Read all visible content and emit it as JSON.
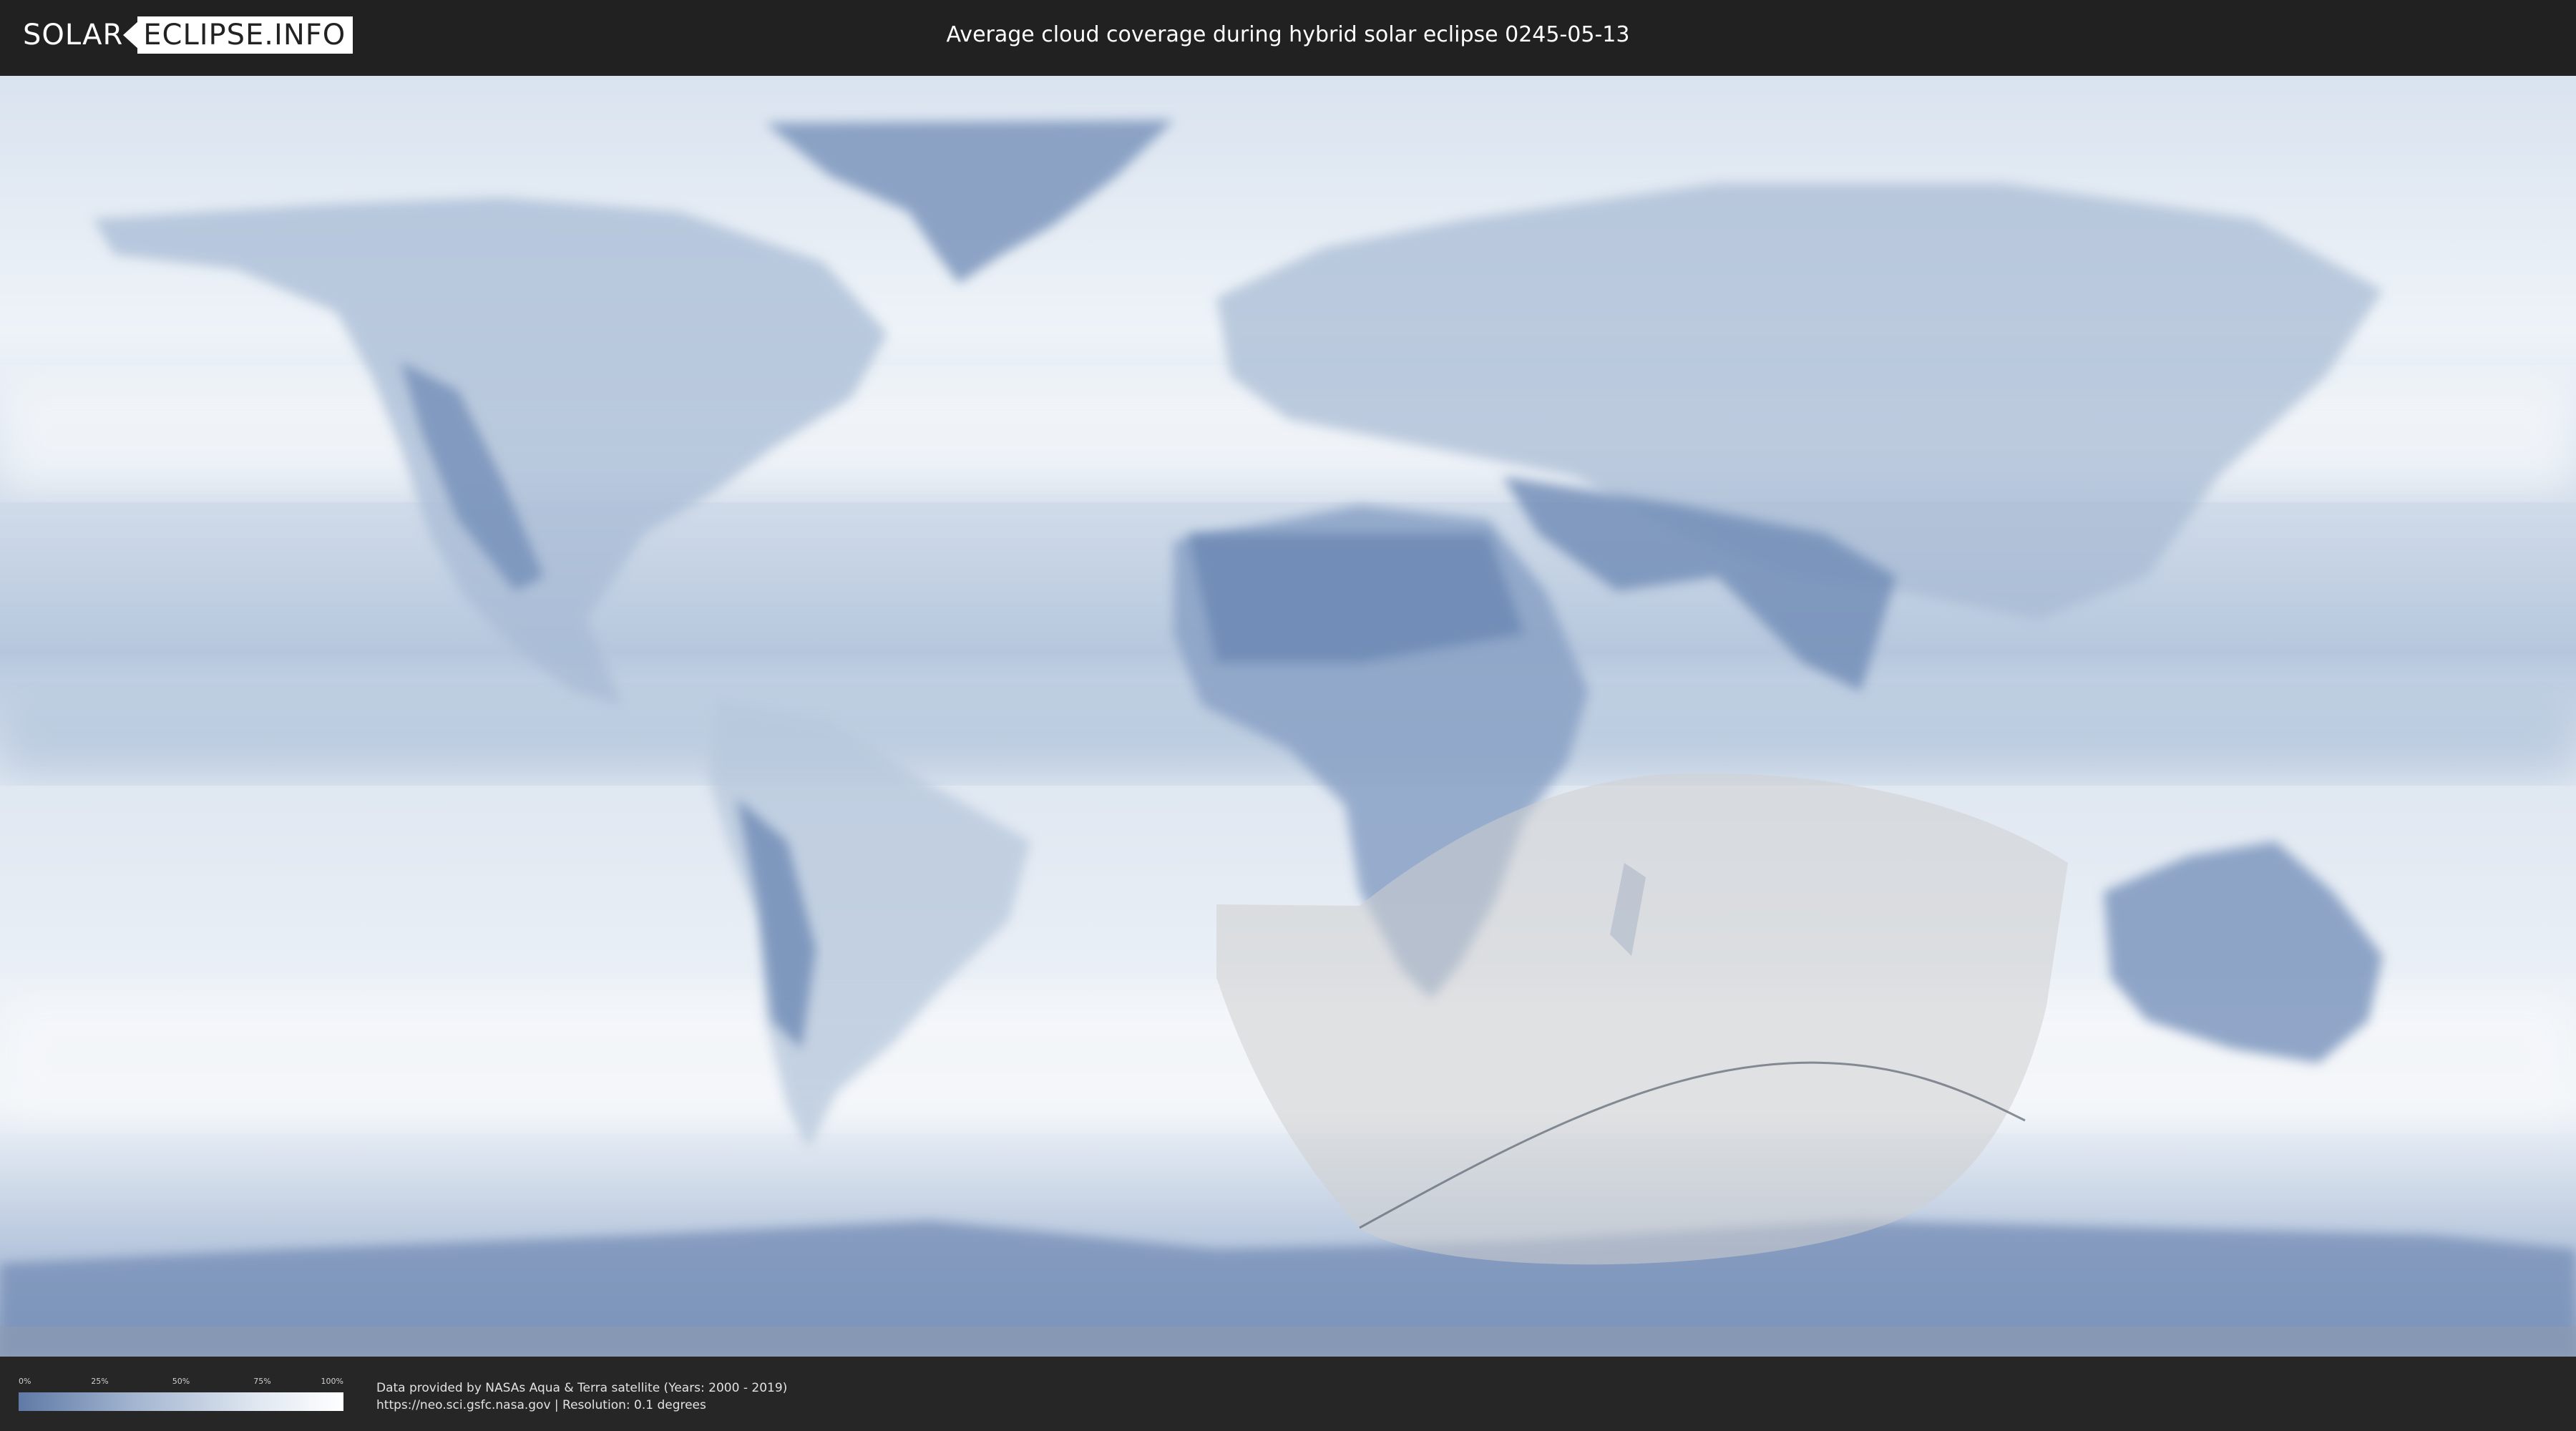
{
  "header": {
    "logo_left": "SOLAR",
    "logo_right": "ECLIPSE.INFO",
    "title": "Average cloud coverage during hybrid solar eclipse 0245-05-13"
  },
  "legend": {
    "ticks": [
      "0%",
      "25%",
      "50%",
      "75%",
      "100%"
    ],
    "colors": [
      "#5f7aa6",
      "#a2b4cf",
      "#e2e9f2",
      "#ffffff"
    ]
  },
  "footer": {
    "credit_line1": "Data provided by NASAs Aqua & Terra satellite (Years: 2000 - 2019)",
    "credit_line2": "https://neo.sci.gsfc.nasa.gov | Resolution: 0.1 degrees"
  },
  "map": {
    "base_color": "#dfe7f1",
    "land_color": "#7f98bf",
    "eclipse_zone_color": "#cfcfcf"
  }
}
